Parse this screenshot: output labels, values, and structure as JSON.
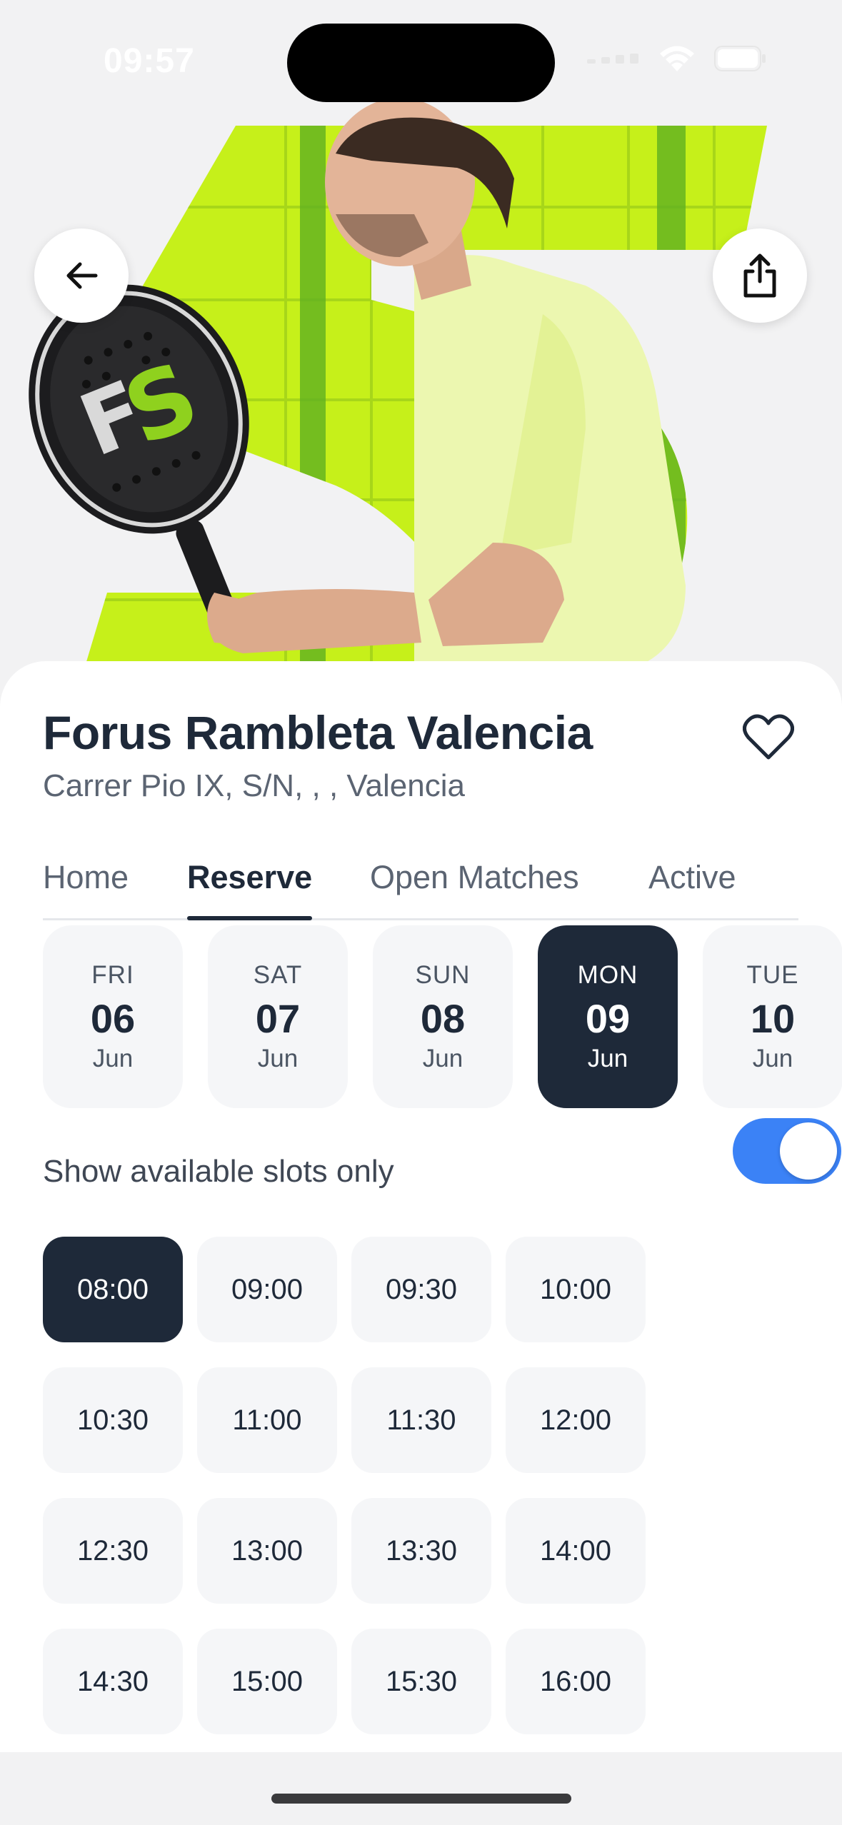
{
  "status_bar": {
    "time": "09:57"
  },
  "hero": {
    "image_description_icon": "padel-player-photo"
  },
  "venue": {
    "name": "Forus Rambleta Valencia",
    "address": "Carrer Pio IX, S/N, , , Valencia"
  },
  "tabs": [
    {
      "label": "Home",
      "active": false
    },
    {
      "label": "Reserve",
      "active": true
    },
    {
      "label": "Open Matches",
      "active": false
    },
    {
      "label": "Active",
      "active": false
    }
  ],
  "dates": [
    {
      "dow": "FRI",
      "day": "06",
      "month": "Jun",
      "selected": false
    },
    {
      "dow": "SAT",
      "day": "07",
      "month": "Jun",
      "selected": false
    },
    {
      "dow": "SUN",
      "day": "08",
      "month": "Jun",
      "selected": false
    },
    {
      "dow": "MON",
      "day": "09",
      "month": "Jun",
      "selected": true
    },
    {
      "dow": "TUE",
      "day": "10",
      "month": "Jun",
      "selected": false
    }
  ],
  "filter": {
    "label": "Show available slots only",
    "enabled": true
  },
  "slots": [
    {
      "time": "08:00",
      "selected": true
    },
    {
      "time": "09:00",
      "selected": false
    },
    {
      "time": "09:30",
      "selected": false
    },
    {
      "time": "10:00",
      "selected": false
    },
    {
      "time": "10:30",
      "selected": false
    },
    {
      "time": "11:00",
      "selected": false
    },
    {
      "time": "11:30",
      "selected": false
    },
    {
      "time": "12:00",
      "selected": false
    },
    {
      "time": "12:30",
      "selected": false
    },
    {
      "time": "13:00",
      "selected": false
    },
    {
      "time": "13:30",
      "selected": false
    },
    {
      "time": "14:00",
      "selected": false
    },
    {
      "time": "14:30",
      "selected": false
    },
    {
      "time": "15:00",
      "selected": false
    },
    {
      "time": "15:30",
      "selected": false
    },
    {
      "time": "16:00",
      "selected": false
    }
  ],
  "colors": {
    "primary_dark": "#1e2939",
    "toggle_on": "#3b82f6",
    "brand_green": "#c6f01a"
  }
}
